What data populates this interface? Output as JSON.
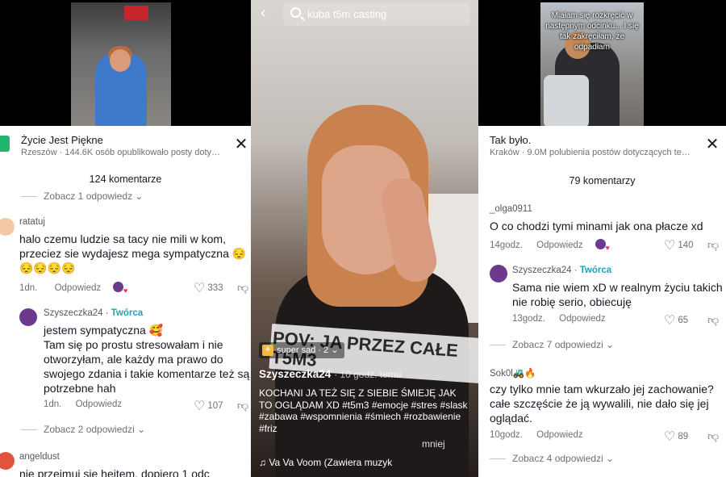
{
  "left": {
    "sheet_title": "Życie Jest Piękne",
    "sheet_sub": "Rzeszów · 144.6K osób opublikowało posty dotyc…",
    "comment_count": "124 komentarze",
    "top_replies": "Zobacz 1 odpowiedz",
    "comments": [
      {
        "user": "ratatuj",
        "text": "halo czemu ludzie sa tacy nie mili w kom, przeciez sie wydajesz mega sympatyczna 😔",
        "text2": "😔😔😔😔",
        "age": "1dn.",
        "reply": "Odpowiedz",
        "likes": "333"
      },
      {
        "user": "Szyszeczka24",
        "creator": "Twórca",
        "text": "jestem sympatyczna 🥰",
        "text2": "Tam się po prostu stresowałam i nie otworzyłam, ale każdy ma prawo do swojego zdania i takie komentarze też są potrzebne hah",
        "age": "1dn.",
        "reply": "Odpowiedz",
        "likes": "107"
      },
      {
        "user": "angeldust",
        "text": "nie przejmuj sie heitem, dopiero 1 odc"
      }
    ],
    "mid_replies": "Zobacz 2 odpowiedzi"
  },
  "mid": {
    "search": "kuba t5m casting",
    "overlay": "POV: JA PRZEZ CAŁE T5M3",
    "sound_chip": "super sad · 2",
    "author": "Szyszeczka24",
    "author_date": "· 10 godz. temu",
    "desc": "KOCHANI JA TEŻ SIĘ Z SIEBIE ŚMIEJĘ JAK TO OGLĄDAM XD #t5m3 #emocje #stres #slask #zabawa #wspomnienia #śmiech #rozbawienie #friz",
    "more": "mniej",
    "music": "Va Va Voom (Zawiera muzyk"
  },
  "right": {
    "thumb_caption": "Miałam się rozkręcić w następnym odcinku... I się tak zakręciłam, że odpadłam",
    "sheet_title": "Tak było.",
    "sheet_sub": "Kraków · 9.0M polubienia postów dotyczących te…",
    "comment_count": "79 komentarzy",
    "comments": [
      {
        "user": "_olga0911",
        "text": "O co chodzi tymi minami jak ona płacze xd",
        "age": "14godz.",
        "reply": "Odpowiedz",
        "likes": "140"
      },
      {
        "user": "Szyszeczka24",
        "creator": "Twórca",
        "text": "Sama nie wiem xD w realnym życiu takich nie robię serio, obiecuję",
        "age": "13godz.",
        "reply": "Odpowiedz",
        "likes": "65",
        "more": "Zobacz 7 odpowiedzi"
      },
      {
        "user": "Sok0l🚜🔥",
        "text": "czy tylko mnie tam wkurzało jej zachowanie? całe szczęście że ją wywalili, nie dało się jej oglądać.",
        "age": "10godz.",
        "reply": "Odpowiedz",
        "likes": "89",
        "more": "Zobacz 4 odpowiedzi"
      }
    ]
  }
}
